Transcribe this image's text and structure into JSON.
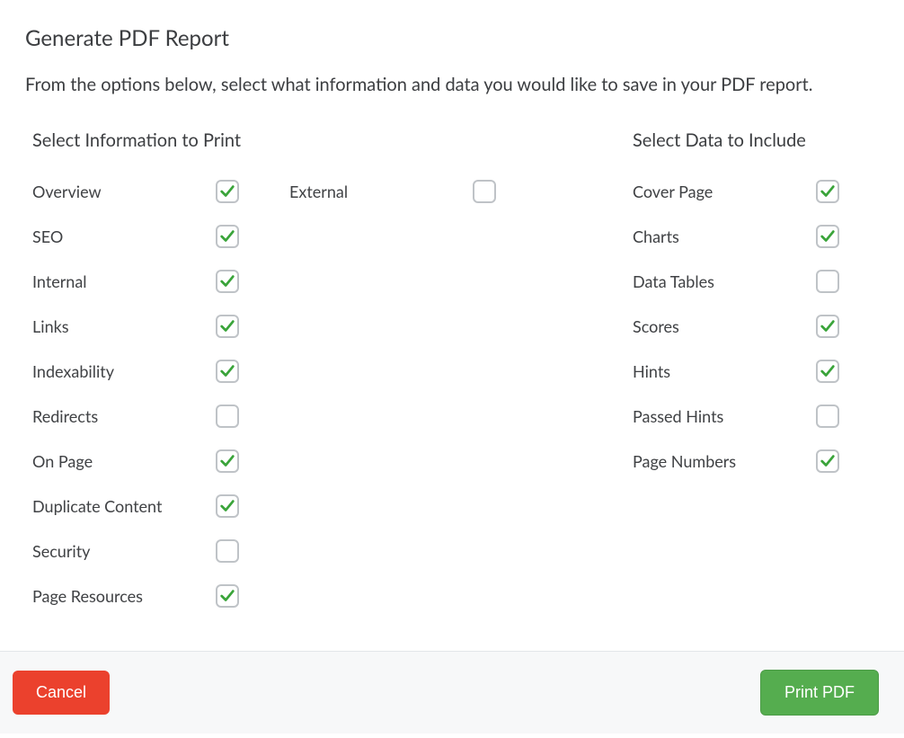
{
  "title": "Generate PDF Report",
  "description": "From the options below, select what information and data you would like to save in your PDF report.",
  "info_section": {
    "heading": "Select Information to Print",
    "col_a": [
      {
        "label": "Overview",
        "checked": true
      },
      {
        "label": "SEO",
        "checked": true
      },
      {
        "label": "Internal",
        "checked": true
      },
      {
        "label": "Links",
        "checked": true
      },
      {
        "label": "Indexability",
        "checked": true
      },
      {
        "label": "Redirects",
        "checked": false
      },
      {
        "label": "On Page",
        "checked": true
      },
      {
        "label": "Duplicate Content",
        "checked": true
      },
      {
        "label": "Security",
        "checked": false
      },
      {
        "label": "Page Resources",
        "checked": true
      }
    ],
    "col_b": [
      {
        "label": "External",
        "checked": false
      }
    ]
  },
  "data_section": {
    "heading": "Select Data to Include",
    "items": [
      {
        "label": "Cover Page",
        "checked": true
      },
      {
        "label": "Charts",
        "checked": true
      },
      {
        "label": "Data Tables",
        "checked": false
      },
      {
        "label": "Scores",
        "checked": true
      },
      {
        "label": "Hints",
        "checked": true
      },
      {
        "label": "Passed Hints",
        "checked": false
      },
      {
        "label": "Page Numbers",
        "checked": true
      }
    ]
  },
  "footer": {
    "cancel_label": "Cancel",
    "primary_label": "Print PDF"
  }
}
